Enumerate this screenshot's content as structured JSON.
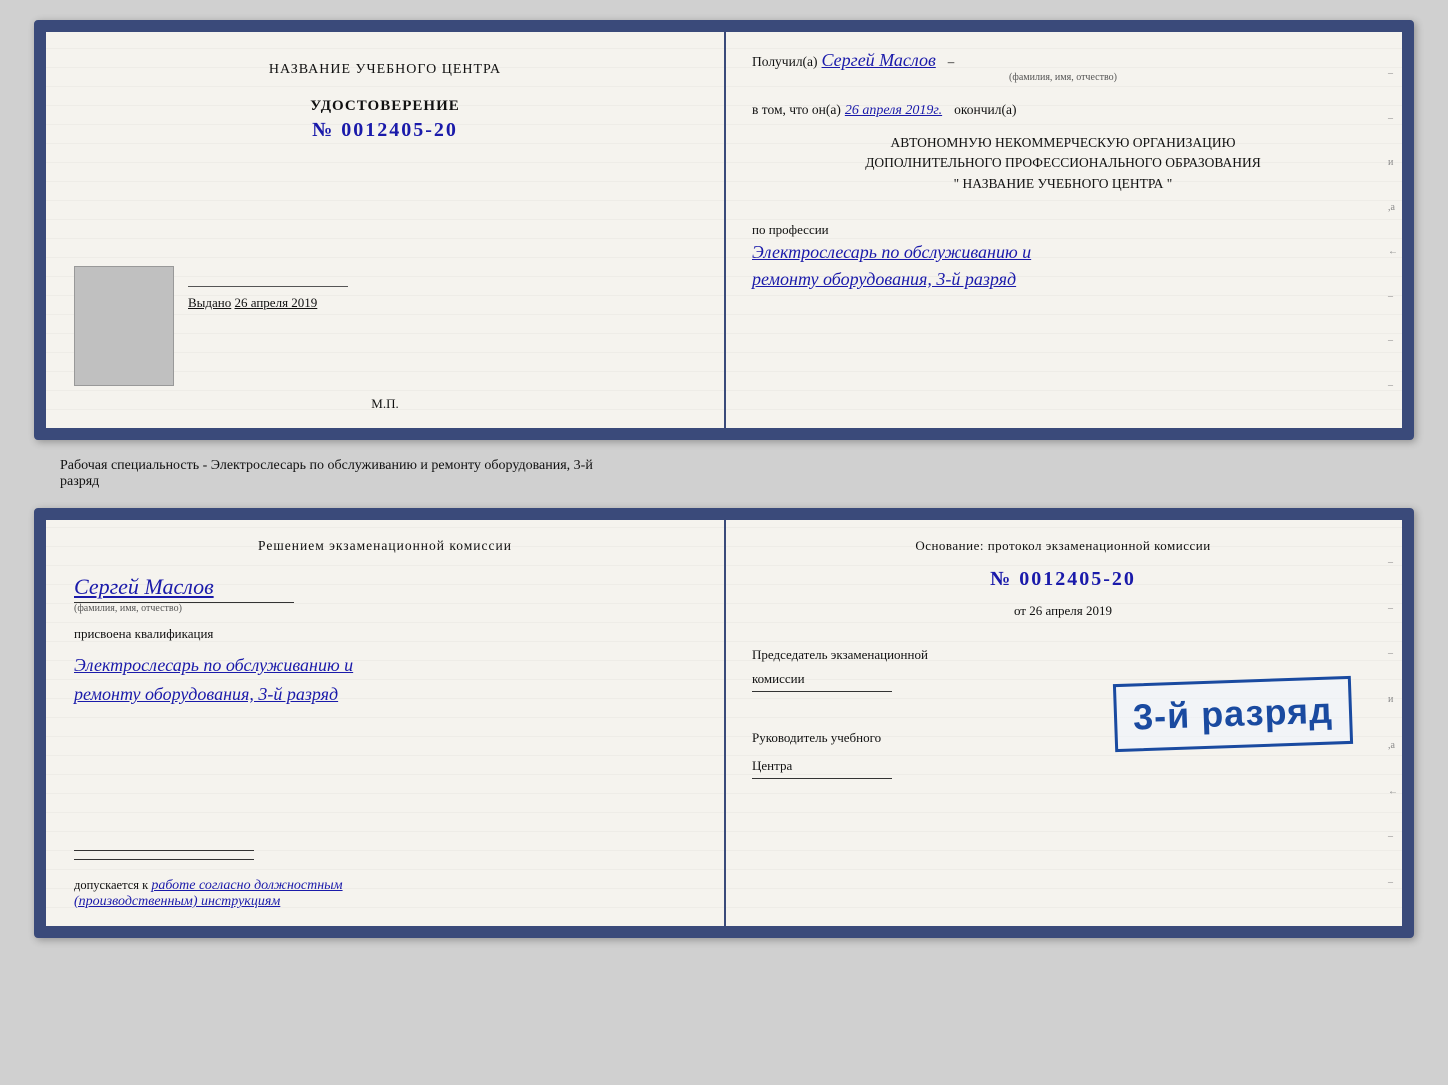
{
  "top_card": {
    "left": {
      "org_name": "НАЗВАНИЕ УЧЕБНОГО ЦЕНТРА",
      "cert_title": "УДОСТОВЕРЕНИЕ",
      "cert_number_prefix": "№",
      "cert_number": "0012405-20",
      "issued_label": "Выдано",
      "issued_date": "26 апреля 2019",
      "mp_label": "М.П."
    },
    "right": {
      "received_prefix": "Получил(а)",
      "received_name": "Сергей Маслов",
      "fio_label": "(фамилия, имя, отчество)",
      "dash": "–",
      "vtom_prefix": "в том, что он(а)",
      "vtom_date": "26 апреля 2019г.",
      "vtom_suffix": "окончил(а)",
      "org_line1": "АВТОНОМНУЮ НЕКОММЕРЧЕСКУЮ ОРГАНИЗАЦИЮ",
      "org_line2": "ДОПОЛНИТЕЛЬНОГО ПРОФЕССИОНАЛЬНОГО ОБРАЗОВАНИЯ",
      "org_name_quotes": "\"  НАЗВАНИЕ УЧЕБНОГО ЦЕНТРА  \"",
      "po_professii": "по профессии",
      "profession_line1": "Электрослесарь по обслуживанию и",
      "profession_line2": "ремонту оборудования, 3-й разряд"
    }
  },
  "label_between": "Рабочая специальность - Электрослесарь по обслуживанию и ремонту оборудования, 3-й\nразряд",
  "bottom_card": {
    "left": {
      "decision_title": "Решением экзаменационной  комиссии",
      "person_name": "Сергей Маслов",
      "fio_label": "(фамилия, имя, отчество)",
      "assigned_label": "присвоена квалификация",
      "qual_line1": "Электрослесарь по обслуживанию и",
      "qual_line2": "ремонту оборудования, 3-й разряд",
      "dopusk_prefix": "допускается к",
      "dopusk_text": "работе согласно должностным",
      "dopusk_text2": "(производственным) инструкциям"
    },
    "right": {
      "osnование": "Основание: протокол экзаменационной  комиссии",
      "protocol_prefix": "№",
      "protocol_number": "0012405-20",
      "ot_prefix": "от",
      "ot_date": "26 апреля 2019",
      "predsedatel_label": "Председатель экзаменационной",
      "komissii": "комиссии",
      "rukovoditel": "Руководитель учебного",
      "centra": "Центра"
    },
    "stamp": {
      "text": "3-й разряд"
    }
  },
  "side_marks": {
    "и": "и",
    "а": "а",
    "back": "←",
    "dashes": [
      "–",
      "–",
      "–",
      "–",
      "–"
    ]
  }
}
